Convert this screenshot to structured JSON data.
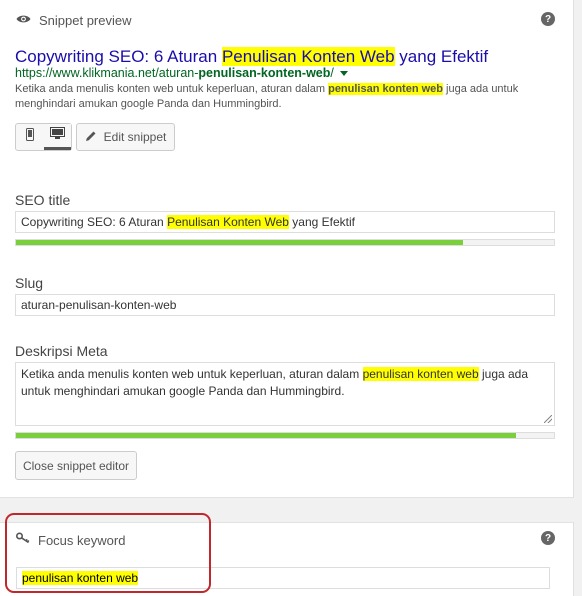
{
  "snippet_preview": {
    "header_label": "Snippet preview",
    "help": "?",
    "title_before": "Copywriting SEO: 6 Aturan ",
    "title_highlight": "Penulisan Konten Web",
    "title_after": " yang Efektif",
    "url_before": "https://www.klikmania.net/aturan-",
    "url_bold": "penulisan-konten-web",
    "url_after": "/",
    "desc_before": "Ketika anda menulis konten web untuk keperluan, aturan dalam ",
    "desc_highlight": "penulisan konten web",
    "desc_after": " juga ada untuk menghindari amukan google Panda dan Hummingbird.",
    "edit_label": "Edit snippet"
  },
  "seo_title": {
    "label": "SEO title",
    "value_before": "Copywriting SEO: 6 Aturan ",
    "value_highlight": "Penulisan Konten Web",
    "value_after": " yang Efektif",
    "progress": 0.83
  },
  "slug": {
    "label": "Slug",
    "value": "aturan-penulisan-konten-web"
  },
  "meta": {
    "label": "Deskripsi Meta",
    "value_before": "Ketika anda menulis konten web untuk keperluan, aturan dalam ",
    "value_highlight": "penulisan konten web",
    "value_after": " juga ada untuk menghindari amukan google Panda dan Hummingbird.",
    "progress": 0.93
  },
  "close_label": "Close snippet editor",
  "focus_keyword": {
    "label": "Focus keyword",
    "help": "?",
    "value": "penulisan konten web"
  },
  "colors": {
    "link": "#1a0dab",
    "url": "#006621",
    "highlight": "#ffff00",
    "progress_good": "#7ad03a",
    "annotation": "#c0282d"
  }
}
